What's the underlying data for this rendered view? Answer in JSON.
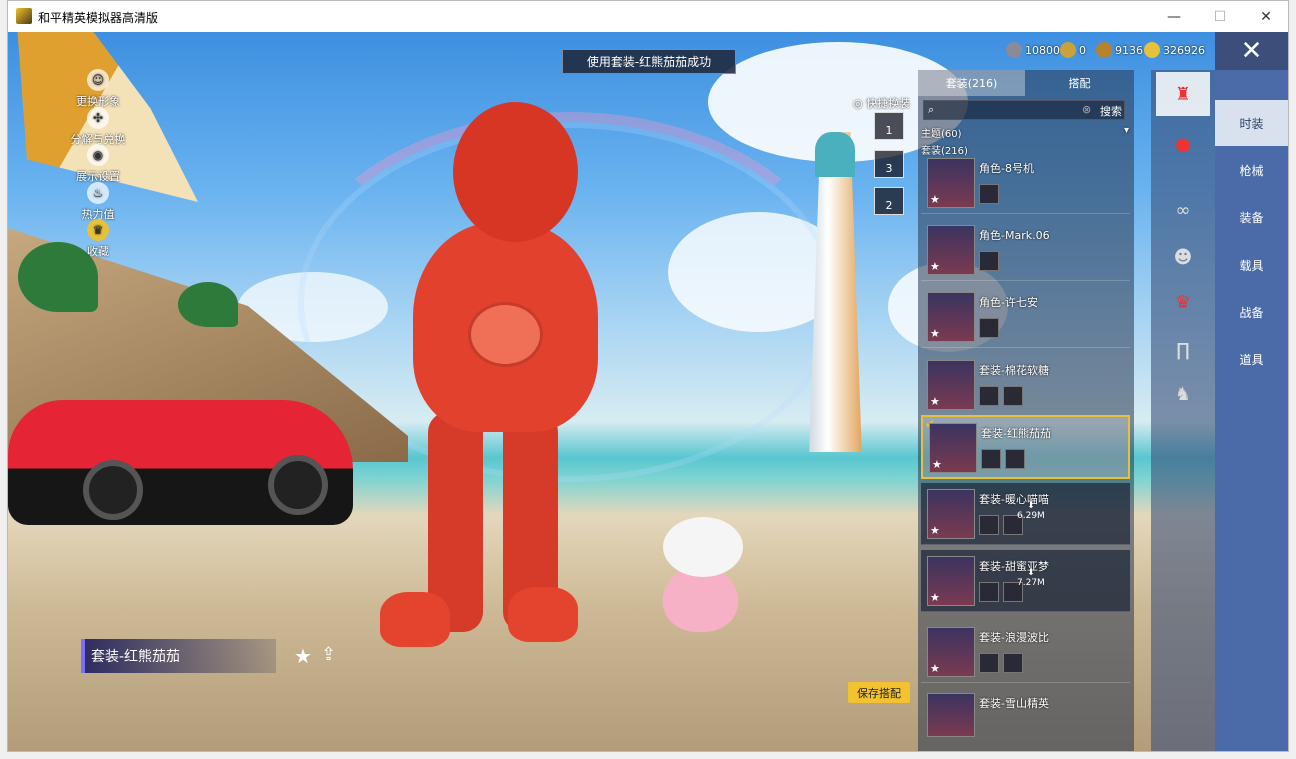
{
  "window": {
    "title": "和平精英模拟器高清版",
    "controls": {
      "minimize": "—",
      "maximize": "☐",
      "close": "✕"
    }
  },
  "notice": "使用套装-红熊茄茄成功",
  "left_menu": [
    {
      "label": "更换形象",
      "icon": "person-icon"
    },
    {
      "label": "分解与兑换",
      "icon": "recycle-icon"
    },
    {
      "label": "展示设置",
      "icon": "eye-icon"
    },
    {
      "label": "热力值",
      "icon": "flame-icon"
    },
    {
      "label": "收藏",
      "icon": "badge-icon"
    }
  ],
  "currencies": [
    {
      "value": "10800",
      "color": "#8a8a9a"
    },
    {
      "value": "0",
      "color": "#c9a23a"
    },
    {
      "value": "9136",
      "color": "#b7822e"
    },
    {
      "value": "326926",
      "color": "#e8c13a"
    }
  ],
  "quick_swap": {
    "label": "快捷换装",
    "slots": [
      "1",
      "3",
      "2"
    ]
  },
  "panel": {
    "tabs": [
      {
        "label": "套装(216)",
        "active": true
      },
      {
        "label": "搭配",
        "active": false
      }
    ],
    "search_placeholder": "",
    "search_label": "搜索",
    "filter_theme": "主题(60)",
    "filter_suit": "套装(216)",
    "items": [
      {
        "name": "角色-8号机",
        "minis": 1
      },
      {
        "name": "角色-Mark.06",
        "minis": 1
      },
      {
        "name": "角色-许七安",
        "minis": 1
      },
      {
        "name": "套装-棉花软糖",
        "minis": 2
      },
      {
        "name": "套装-红熊茄茄",
        "minis": 2,
        "selected": true
      },
      {
        "name": "套装-暖心喵喵",
        "minis": 2,
        "download": "6.29M"
      },
      {
        "name": "套装-甜蜜亚梦",
        "minis": 2,
        "download": "7.27M"
      },
      {
        "name": "套装-浪漫波比",
        "minis": 2
      },
      {
        "name": "套装-雪山精英",
        "minis": 0
      }
    ]
  },
  "icon_column": [
    "outfit-icon",
    "cherry-icon",
    "glasses-icon",
    "mask-icon",
    "top-icon",
    "pants-icon",
    "shoes-icon"
  ],
  "categories": [
    {
      "label": "时装",
      "active": true
    },
    {
      "label": "枪械"
    },
    {
      "label": "装备"
    },
    {
      "label": "载具"
    },
    {
      "label": "战备"
    },
    {
      "label": "道具"
    }
  ],
  "outfit_label": "套装-红熊茄茄",
  "save_label": "保存搭配",
  "close_glyph": "✕"
}
